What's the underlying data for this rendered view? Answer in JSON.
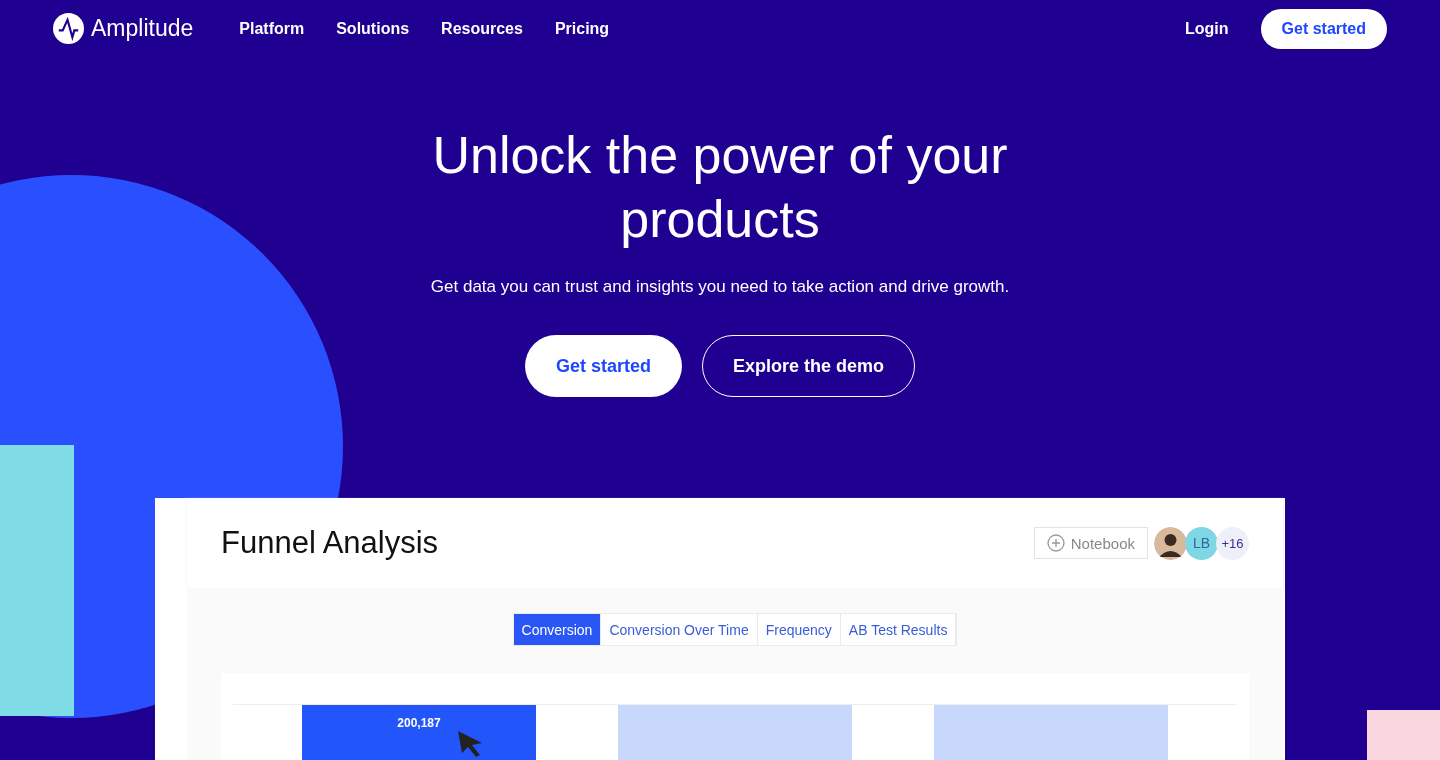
{
  "nav": {
    "brand": "Amplitude",
    "links": [
      "Platform",
      "Solutions",
      "Resources",
      "Pricing"
    ],
    "login": "Login",
    "cta": "Get started"
  },
  "hero": {
    "title": "Unlock the power of your products",
    "subtitle": "Get data you can trust and insights you need to take action and drive growth.",
    "primary": "Get started",
    "secondary": "Explore the demo"
  },
  "preview": {
    "title": "Funnel Analysis",
    "notebook": "Notebook",
    "avatars": [
      {
        "kind": "photo"
      },
      {
        "kind": "initials",
        "text": "LB"
      },
      {
        "kind": "count",
        "text": "+16"
      }
    ],
    "tabs": [
      {
        "label": "Conversion",
        "selected": true
      },
      {
        "label": "Conversion Over Time",
        "selected": false
      },
      {
        "label": "Frequency",
        "selected": false
      },
      {
        "label": "AB Test Results",
        "selected": false
      }
    ],
    "bars": [
      {
        "selected": true,
        "label": "200,187"
      },
      {
        "selected": false
      },
      {
        "selected": false
      }
    ]
  }
}
